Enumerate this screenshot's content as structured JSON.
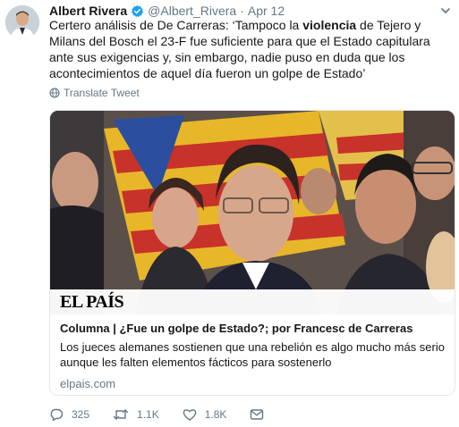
{
  "tweet": {
    "author_name": "Albert Rivera",
    "handle": "@Albert_Rivera",
    "separator": "·",
    "date": "Apr 12",
    "text_parts": {
      "p1": "Certero análisis de De Carreras: ‘Tampoco la ",
      "bold": "violencia",
      "p2": " de Tejero y Milans del Bosch el 23-F fue suficiente para que el Estado capitulara ante sus exigencias y, sin embargo, nadie puso en duda que los acontecimientos de aquel día fueron un golpe de Estado’"
    },
    "translate_label": "Translate Tweet"
  },
  "card": {
    "brand": "EL PAÍS",
    "title": "Columna | ¿Fue un golpe de Estado?; por Francesc de Carreras",
    "description": "Los jueces alemanes sostienen que una rebelión es algo mucho más serio aunque les falten elementos fácticos para sostenerlo",
    "domain": "elpais.com"
  },
  "actions": {
    "replies": "325",
    "retweets": "1.1K",
    "likes": "1.8K"
  },
  "icons": {
    "avatar": "avatar-photo",
    "verified": "verified-badge-icon",
    "more": "chevron-down-icon",
    "translate": "globe-icon",
    "reply": "reply-icon",
    "retweet": "retweet-icon",
    "like": "heart-icon",
    "message": "envelope-icon"
  },
  "colors": {
    "text": "#14171a",
    "secondary": "#657786",
    "verified": "#1da1f2",
    "border": "#e1e8ed"
  }
}
